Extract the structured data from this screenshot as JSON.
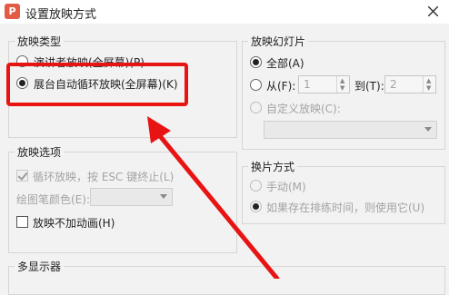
{
  "dialog": {
    "title": "设置放映方式",
    "app_icon": "P"
  },
  "show_type": {
    "title": "放映类型",
    "options": [
      {
        "label": "演讲者放映(全屏幕)(P)",
        "checked": false
      },
      {
        "label": "展台自动循环放映(全屏幕)(K)",
        "checked": true
      }
    ]
  },
  "slides": {
    "title": "放映幻灯片",
    "all_label": "全部(A)",
    "from_label": "从(F):",
    "from_value": "1",
    "to_label": "到(T):",
    "to_value": "2",
    "custom_label": "自定义放映(C):"
  },
  "show_options": {
    "title": "放映选项",
    "loop_label": "循环放映，按 ESC 键终止(L)",
    "pen_color_label": "绘图笔颜色(E):",
    "no_animation_label": "放映不加动画(H)"
  },
  "transition": {
    "title": "换片方式",
    "manual_label": "手动(M)",
    "timing_label": "如果存在排练时间，则使用它(U)"
  },
  "multi_display": {
    "title": "多显示器"
  },
  "annotation": {
    "color": "#e81414"
  }
}
